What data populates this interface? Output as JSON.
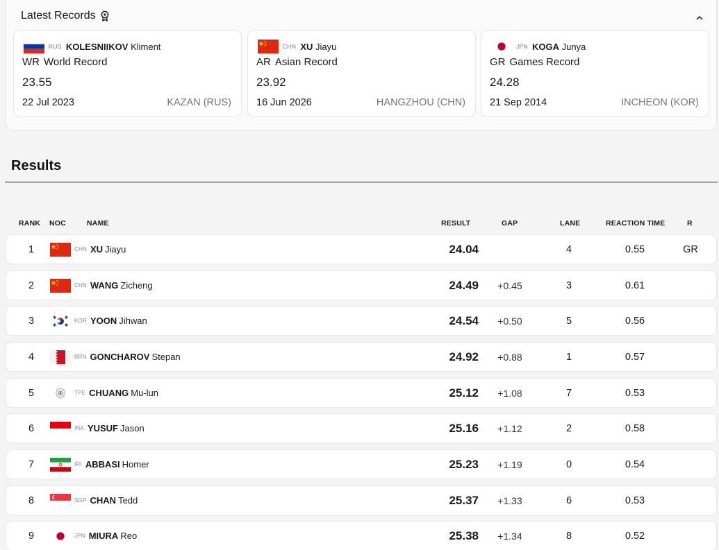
{
  "latest_records": {
    "title": "Latest Records",
    "cards": [
      {
        "noc": "RUS",
        "surname": "KOLESNIIKOV",
        "given": "Kliment",
        "abbr": "WR",
        "label": "World Record",
        "value": "23.55",
        "date": "22 Jul 2023",
        "place": "KAZAN (RUS)",
        "flag": "rus"
      },
      {
        "noc": "CHN",
        "surname": "XU",
        "given": "Jiayu",
        "abbr": "AR",
        "label": "Asian Record",
        "value": "23.92",
        "date": "16 Jun 2026",
        "place": "HANGZHOU (CHN)",
        "flag": "chn"
      },
      {
        "noc": "JPN",
        "surname": "KOGA",
        "given": "Junya",
        "abbr": "GR",
        "label": "Games Record",
        "value": "24.28",
        "date": "21 Sep 2014",
        "place": "INCHEON (KOR)",
        "flag": "jpn"
      }
    ]
  },
  "results": {
    "title": "Results",
    "columns": {
      "rank": "RANK",
      "noc": "NOC",
      "name": "NAME",
      "result": "RESULT",
      "gap": "GAP",
      "lane": "LANE",
      "reaction": "REACTION TIME",
      "record": "R"
    },
    "rows": [
      {
        "rank": "1",
        "noc": "CHN",
        "surname": "XU",
        "given": "Jiayu",
        "result": "24.04",
        "gap": "",
        "lane": "4",
        "reaction": "0.55",
        "record": "GR",
        "flag": "chn"
      },
      {
        "rank": "2",
        "noc": "CHN",
        "surname": "WANG",
        "given": "Zicheng",
        "result": "24.49",
        "gap": "+0.45",
        "lane": "3",
        "reaction": "0.61",
        "record": "",
        "flag": "chn"
      },
      {
        "rank": "3",
        "noc": "KOR",
        "surname": "YOON",
        "given": "Jihwan",
        "result": "24.54",
        "gap": "+0.50",
        "lane": "5",
        "reaction": "0.56",
        "record": "",
        "flag": "kor"
      },
      {
        "rank": "4",
        "noc": "BRN",
        "surname": "GONCHAROV",
        "given": "Stepan",
        "result": "24.92",
        "gap": "+0.88",
        "lane": "1",
        "reaction": "0.57",
        "record": "",
        "flag": "brn"
      },
      {
        "rank": "5",
        "noc": "TPE",
        "surname": "CHUANG",
        "given": "Mu-lun",
        "result": "25.12",
        "gap": "+1.08",
        "lane": "7",
        "reaction": "0.53",
        "record": "",
        "flag": "tpe"
      },
      {
        "rank": "6",
        "noc": "INA",
        "surname": "YUSUF",
        "given": "Jason",
        "result": "25.16",
        "gap": "+1.12",
        "lane": "2",
        "reaction": "0.58",
        "record": "",
        "flag": "ina"
      },
      {
        "rank": "7",
        "noc": "IRI",
        "surname": "ABBASI",
        "given": "Homer",
        "result": "25.23",
        "gap": "+1.19",
        "lane": "0",
        "reaction": "0.54",
        "record": "",
        "flag": "iri"
      },
      {
        "rank": "8",
        "noc": "SGP",
        "surname": "CHAN",
        "given": "Tedd",
        "result": "25.37",
        "gap": "+1.33",
        "lane": "6",
        "reaction": "0.53",
        "record": "",
        "flag": "sgp"
      },
      {
        "rank": "9",
        "noc": "JPN",
        "surname": "MIURA",
        "given": "Reo",
        "result": "25.38",
        "gap": "+1.34",
        "lane": "8",
        "reaction": "0.52",
        "record": "",
        "flag": "jpn"
      }
    ]
  },
  "icons": {
    "records_header": "medal-icon",
    "collapse": "chevron-up-icon"
  },
  "colors": {
    "china_red": "#de2910",
    "japan_red": "#bc002d",
    "text": "#1a1a1a",
    "muted": "#767676"
  }
}
